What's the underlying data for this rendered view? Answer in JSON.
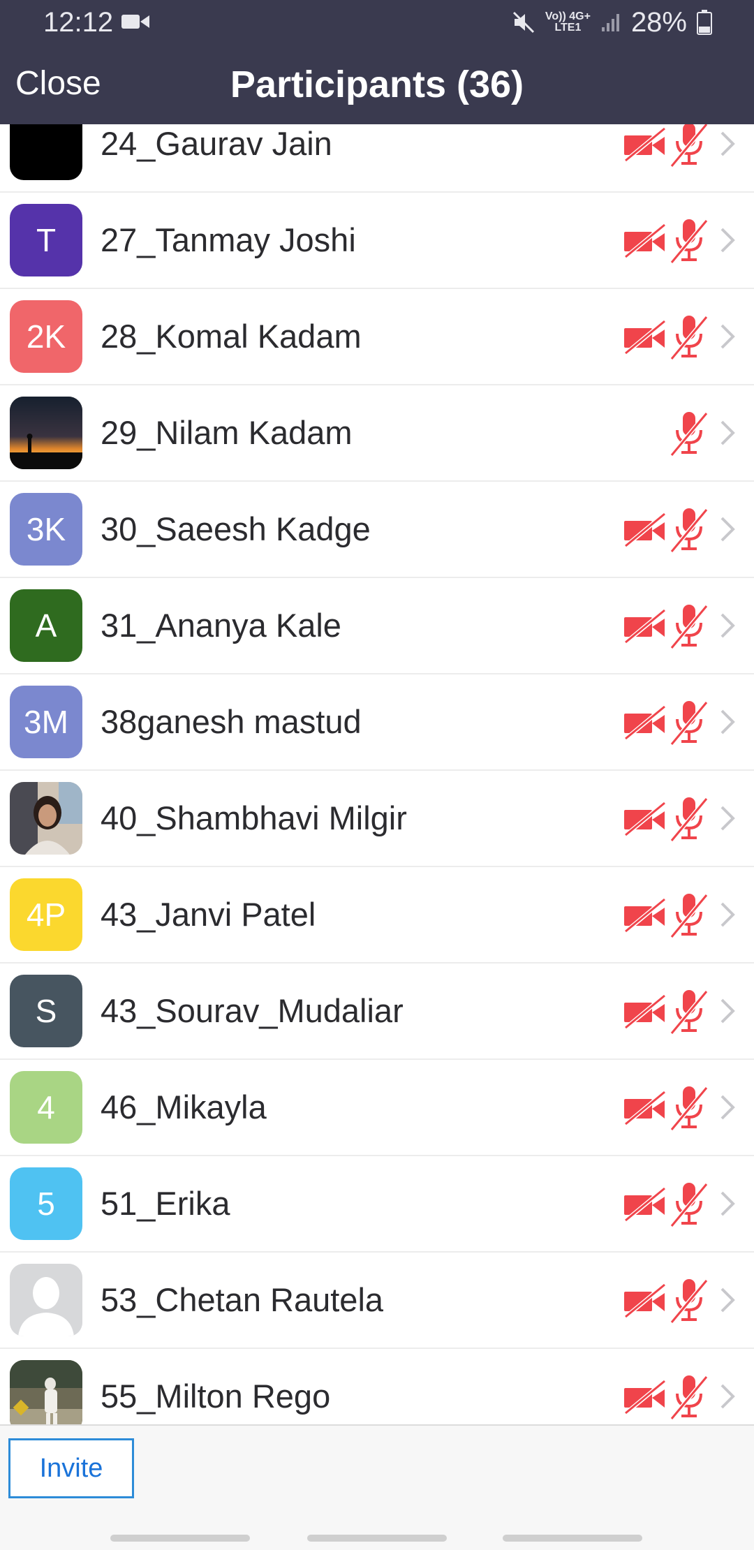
{
  "status_bar": {
    "time": "12:12",
    "net_top": "Vo)) 4G+",
    "net_bottom": "LTE1",
    "battery_pct": "28%",
    "icons": [
      "video-camera-icon",
      "mute-icon",
      "signal-icon",
      "battery-icon"
    ]
  },
  "header": {
    "close_label": "Close",
    "title": "Participants (36)"
  },
  "participants": [
    {
      "name": "24_Gaurav Jain",
      "avatar_text": "",
      "avatar_color": "#000000",
      "avatar_kind": "color",
      "video_off": true,
      "mic_muted": true
    },
    {
      "name": "27_Tanmay Joshi",
      "avatar_text": "T",
      "avatar_color": "#5533aa",
      "avatar_kind": "color",
      "video_off": true,
      "mic_muted": true
    },
    {
      "name": "28_Komal Kadam",
      "avatar_text": "2K",
      "avatar_color": "#f0666a",
      "avatar_kind": "color",
      "video_off": true,
      "mic_muted": true
    },
    {
      "name": "29_Nilam Kadam",
      "avatar_text": "",
      "avatar_color": "#1a1a1a",
      "avatar_kind": "sunset-photo",
      "video_off": false,
      "mic_muted": true
    },
    {
      "name": "30_Saeesh Kadge",
      "avatar_text": "3K",
      "avatar_color": "#7b88cf",
      "avatar_kind": "color",
      "video_off": true,
      "mic_muted": true
    },
    {
      "name": "31_Ananya Kale",
      "avatar_text": "A",
      "avatar_color": "#2f6b1f",
      "avatar_kind": "color",
      "video_off": true,
      "mic_muted": true
    },
    {
      "name": "38ganesh mastud",
      "avatar_text": "3M",
      "avatar_color": "#7b88cf",
      "avatar_kind": "color",
      "video_off": true,
      "mic_muted": true
    },
    {
      "name": "40_Shambhavi Milgir",
      "avatar_text": "",
      "avatar_color": "#b9aa9a",
      "avatar_kind": "person-photo",
      "video_off": true,
      "mic_muted": true
    },
    {
      "name": "43_Janvi Patel",
      "avatar_text": "4P",
      "avatar_color": "#fbd82e",
      "avatar_kind": "color",
      "video_off": true,
      "mic_muted": true
    },
    {
      "name": "43_Sourav_Mudaliar",
      "avatar_text": "S",
      "avatar_color": "#475560",
      "avatar_kind": "color",
      "video_off": true,
      "mic_muted": true
    },
    {
      "name": "46_Mikayla",
      "avatar_text": "4",
      "avatar_color": "#a9d584",
      "avatar_kind": "color",
      "video_off": true,
      "mic_muted": true
    },
    {
      "name": "51_Erika",
      "avatar_text": "5",
      "avatar_color": "#4fc2f2",
      "avatar_kind": "color",
      "video_off": true,
      "mic_muted": true
    },
    {
      "name": "53_Chetan Rautela",
      "avatar_text": "",
      "avatar_color": "#d7d8da",
      "avatar_kind": "default-silhouette",
      "video_off": true,
      "mic_muted": true
    },
    {
      "name": "55_Milton Rego",
      "avatar_text": "",
      "avatar_color": "#5b6b3a",
      "avatar_kind": "cricket-photo",
      "video_off": true,
      "mic_muted": true
    }
  ],
  "footer": {
    "invite_label": "Invite"
  },
  "colors": {
    "header_bg": "#3a3a4f",
    "muted_red": "#f0444b",
    "invite_blue": "#1a73d9"
  }
}
